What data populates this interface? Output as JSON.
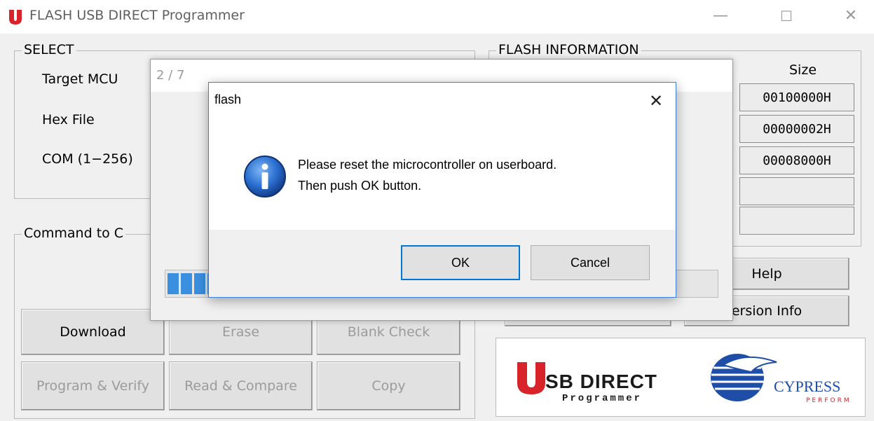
{
  "window": {
    "title": "FLASH USB DIRECT Programmer",
    "controls": {
      "minimize": "—",
      "maximize": "☐",
      "close": "✕"
    }
  },
  "select": {
    "legend": "SELECT",
    "target_label": "Target MCU",
    "hex_label": "Hex File",
    "com_label": "COM (1−256)"
  },
  "flash_info": {
    "legend": "FLASH INFORMATION",
    "size_header": "Size",
    "sizes": [
      "00100000H",
      "00000002H",
      "00008000H",
      "",
      ""
    ]
  },
  "command": {
    "legend": "Command to C",
    "buttons": {
      "download": "Download",
      "erase": "Erase",
      "blank_check": "Blank Check",
      "program_verify": "Program & Verify",
      "read_compare": "Read & Compare",
      "copy": "Copy"
    }
  },
  "side_buttons": {
    "help": "Help",
    "version": "ersion Info"
  },
  "progress_dialog": {
    "step": "2 / 7"
  },
  "message_box": {
    "title": "flash",
    "close": "✕",
    "line1": "Please reset the microcontroller on userboard.",
    "line2": "Then push OK button.",
    "ok": "OK",
    "cancel": "Cancel",
    "icon": "info-icon"
  },
  "logos": {
    "usb_main": "SB DIRECT",
    "usb_sub": "Programmer",
    "cypress": "CYPRESS",
    "cypress_sub": "PERFORM"
  },
  "colors": {
    "accent": "#0078d7",
    "progress": "#3a8fe0",
    "logo_red": "#d8232a",
    "cypress_blue": "#1e4ea8"
  }
}
